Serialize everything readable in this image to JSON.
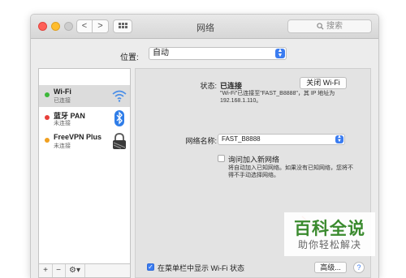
{
  "window": {
    "title": "网络",
    "search_placeholder": "搜索",
    "nav_back": "<",
    "nav_forward": ">"
  },
  "location": {
    "label": "位置:",
    "value": "自动"
  },
  "services": [
    {
      "name": "Wi-Fi",
      "status": "已连接",
      "dot_color": "#3db83a",
      "icon": "wifi-icon",
      "selected": true
    },
    {
      "name": "蓝牙 PAN",
      "status": "未连接",
      "dot_color": "#e8403a",
      "icon": "bluetooth-icon",
      "selected": false
    },
    {
      "name": "FreeVPN Plus",
      "status": "未连接",
      "dot_color": "#f0a020",
      "icon": "vpn-lock-icon",
      "selected": false
    }
  ],
  "sidebar_tools": {
    "add": "+",
    "remove": "−",
    "gear": "⚙▾"
  },
  "detail": {
    "status_label": "状态:",
    "status_value": "已连接",
    "turn_off_button": "关闭 Wi-Fi",
    "status_desc_line1": "\"Wi-Fi\"已连接至\"FAST_B8888\"，其 IP 地址为",
    "status_desc_line2": "192.168.1.110。",
    "network_name_label": "网络名称:",
    "network_name_value": "FAST_B8888",
    "ask_join_label": "询问加入新网络",
    "ask_join_desc_line1": "将自动加入已知网络。如果没有已知网络，您将不",
    "ask_join_desc_line2": "得不手动选择网络。",
    "show_menubar_label": "在菜单栏中显示 Wi-Fi 状态",
    "advanced_button": "高级...",
    "help": "?"
  },
  "watermark": {
    "main": "百科全说",
    "sub": "助你轻松解决"
  },
  "colors": {
    "accent": "#3b7cf0",
    "watermark_green": "#3a8a2e"
  }
}
